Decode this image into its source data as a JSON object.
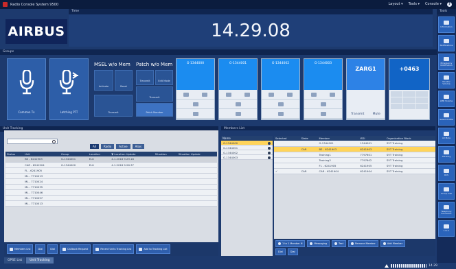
{
  "window": {
    "title": "Radio Console System 9500",
    "menus": [
      "Layout ▾",
      "Tools ▾",
      "Console ▾"
    ],
    "help_glyph": "?"
  },
  "sections": {
    "time": "Time",
    "groups": "Groups",
    "tools": "Tools",
    "unit_tracking": "Unit Tracking",
    "members_list": "Members List"
  },
  "header": {
    "logo": "AIRBUS",
    "clock": "14.29.08"
  },
  "groups": {
    "mic_cards": [
      {
        "label": "Common Tx"
      },
      {
        "label": "Latching PTT"
      }
    ],
    "msel": {
      "title": "MSEL w/o Mem",
      "activate": "Activate",
      "reset": "Reset",
      "patch_btn": "Transmit"
    },
    "patch": {
      "title": "Patch w/o Mem",
      "ptt": "Transmit",
      "edit": "Edit Mode",
      "transmit": "Transmit",
      "patch_member": "Patch Member"
    },
    "tiles": [
      {
        "name": "G-1344000"
      },
      {
        "name": "G-1344001"
      },
      {
        "name": "G-1344002"
      },
      {
        "name": "G-1344003"
      },
      {
        "name": "ZARG1",
        "f1": "Transmit",
        "f2": "Mute"
      },
      {
        "name": "+0463"
      }
    ]
  },
  "tools": [
    "Information",
    "Notifications",
    "Emergency Notification",
    "Monitor Volume",
    "LMR Volume",
    "Select Profile",
    "All Mute",
    "Tracking",
    "RCS",
    "Group Call",
    "Telephony Connector",
    "1 to 1"
  ],
  "unit_tracking": {
    "filters": [
      "All",
      "Radio",
      "Active",
      "Alias"
    ],
    "columns": [
      "Status",
      "Unit",
      "Group",
      "Location",
      "▼ Location Update",
      "Situation",
      "Situation Update"
    ],
    "rows": [
      {
        "status": "",
        "unit": "BS - 6241903",
        "group": "G-1344001",
        "location": "ELU",
        "update": "4.1.2018 9.29.18",
        "situation": "",
        "situation_update": ""
      },
      {
        "status": "",
        "unit": "CAR - 6241904",
        "group": "G-1344000",
        "location": "ELU",
        "update": "4.1.2018 9.26.37",
        "situation": "",
        "situation_update": ""
      },
      {
        "status": "",
        "unit": "FL - 6241905",
        "group": "",
        "location": "",
        "update": "",
        "situation": "",
        "situation_update": ""
      },
      {
        "status": "",
        "unit": "ML - 7710013",
        "group": "",
        "location": "",
        "update": "",
        "situation": "",
        "situation_update": ""
      },
      {
        "status": "",
        "unit": "ML - 7710024",
        "group": "",
        "location": "",
        "update": "",
        "situation": "",
        "situation_update": ""
      },
      {
        "status": "",
        "unit": "ML - 7710035",
        "group": "",
        "location": "",
        "update": "",
        "situation": "",
        "situation_update": ""
      },
      {
        "status": "",
        "unit": "ML - 7710046",
        "group": "",
        "location": "",
        "update": "",
        "situation": "",
        "situation_update": ""
      },
      {
        "status": "",
        "unit": "ML - 7710057",
        "group": "",
        "location": "",
        "update": "",
        "situation": "",
        "situation_update": ""
      },
      {
        "status": "",
        "unit": "ML - 7710013",
        "group": "",
        "location": "",
        "update": "",
        "situation": "",
        "situation_update": ""
      }
    ],
    "toolbar": [
      "Members List",
      "Dial",
      "Dial",
      "Callback Request",
      "Recent Units Tracking List",
      "Add to Tracking List"
    ]
  },
  "members": {
    "group_col": "Name",
    "groups": [
      "G-1344000",
      "G-1344001",
      "G-1344002",
      "G-1344003"
    ],
    "columns": [
      "Selected",
      "State",
      "Member",
      "ISSI",
      "Organization Block"
    ],
    "rows": [
      {
        "selected": "",
        "state": "",
        "member": "G-1344001",
        "issi": "1344001",
        "org": "SVT Training"
      },
      {
        "selected": "",
        "state": "CAR",
        "member": "BS - 6241903",
        "issi": "6241903",
        "org": "SVT Training"
      },
      {
        "selected": "",
        "state": "",
        "member": "Training1",
        "issi": "7797601",
        "org": "SVT Training"
      },
      {
        "selected": "",
        "state": "",
        "member": "Training2",
        "issi": "7797602",
        "org": "SVT Training"
      },
      {
        "selected": "",
        "state": "",
        "member": "FL - 6241905",
        "issi": "6241905",
        "org": "SVT Training"
      },
      {
        "selected": "✓",
        "state": "CAR",
        "member": "CAR - 6241904",
        "issi": "6241904",
        "org": "SVT Training"
      }
    ],
    "toolbar": [
      "1 to 1 Member N",
      "Messaging",
      "Text",
      "Remove Member",
      "Add Member"
    ],
    "toolbar2": [
      "Dial",
      "Dial"
    ]
  },
  "tabs": [
    "GPSE List",
    "Unit Tracking"
  ],
  "status": {
    "time": "14.29"
  },
  "colors": {
    "highlight": "#ffd45a",
    "accent": "#1b8cf0",
    "background": "#1d3a6e"
  }
}
